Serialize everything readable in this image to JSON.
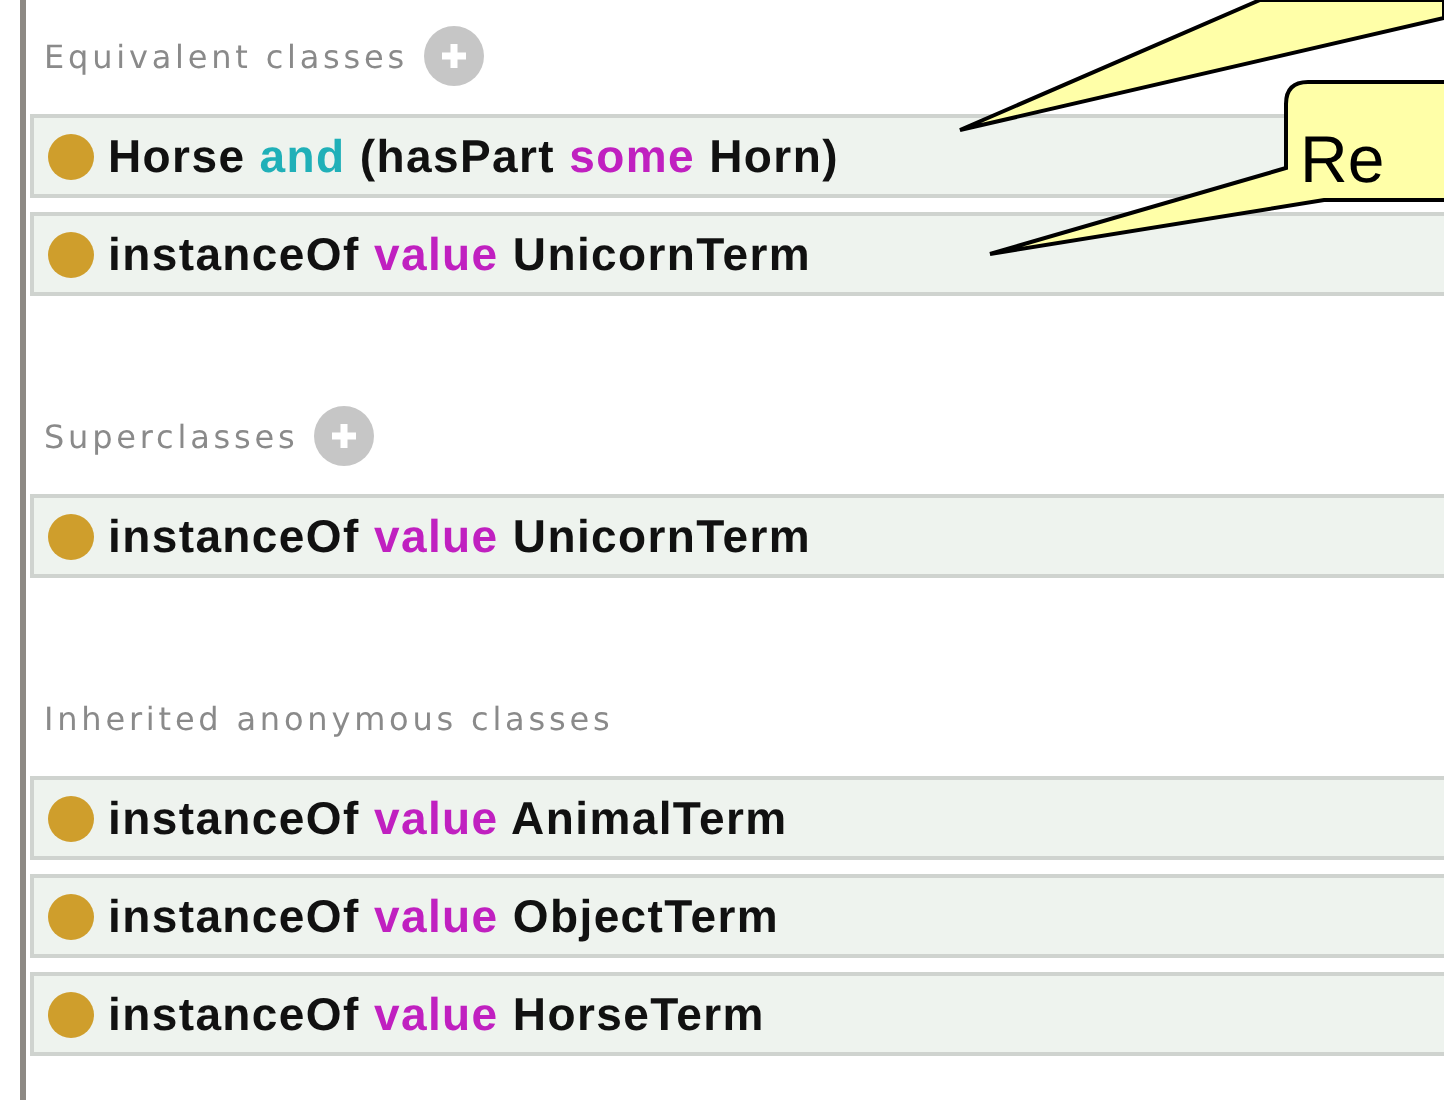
{
  "sections": [
    {
      "title": "Equivalent classes",
      "addable": true,
      "rows": [
        {
          "tokens": [
            {
              "text": "Horse",
              "kind": "entity"
            },
            {
              "text": "and",
              "kind": "logical"
            },
            {
              "text": "(hasPart",
              "kind": "entity"
            },
            {
              "text": "some",
              "kind": "restriction"
            },
            {
              "text": "Horn)",
              "kind": "entity"
            }
          ]
        },
        {
          "tokens": [
            {
              "text": "instanceOf",
              "kind": "entity"
            },
            {
              "text": "value",
              "kind": "restriction"
            },
            {
              "text": "UnicornTerm",
              "kind": "entity"
            }
          ]
        }
      ]
    },
    {
      "title": "Superclasses",
      "addable": true,
      "rows": [
        {
          "tokens": [
            {
              "text": "instanceOf",
              "kind": "entity"
            },
            {
              "text": "value",
              "kind": "restriction"
            },
            {
              "text": "UnicornTerm",
              "kind": "entity"
            }
          ]
        }
      ]
    },
    {
      "title": "Inherited anonymous classes",
      "addable": false,
      "rows": [
        {
          "tokens": [
            {
              "text": "instanceOf",
              "kind": "entity"
            },
            {
              "text": "value",
              "kind": "restriction"
            },
            {
              "text": "AnimalTerm",
              "kind": "entity"
            }
          ]
        },
        {
          "tokens": [
            {
              "text": "instanceOf",
              "kind": "entity"
            },
            {
              "text": "value",
              "kind": "restriction"
            },
            {
              "text": "ObjectTerm",
              "kind": "entity"
            }
          ]
        },
        {
          "tokens": [
            {
              "text": "instanceOf",
              "kind": "entity"
            },
            {
              "text": "value",
              "kind": "restriction"
            },
            {
              "text": "HorseTerm",
              "kind": "entity"
            }
          ]
        }
      ]
    }
  ],
  "callouts": [
    {
      "kind": "pointer"
    },
    {
      "kind": "note",
      "text": "Re"
    }
  ]
}
